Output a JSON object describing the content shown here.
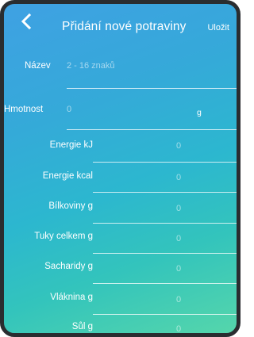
{
  "header": {
    "back_icon": "chevron-left-icon",
    "title": "Přidání nové potraviny",
    "save_label": "Uložit"
  },
  "form": {
    "name": {
      "label": "Název",
      "placeholder": "2 - 16 znaků"
    },
    "weight": {
      "label": "Hmotnost",
      "placeholder": "0",
      "unit": "g"
    },
    "nutrients": [
      {
        "label": "Energie kJ",
        "value": "0"
      },
      {
        "label": "Energie kcal",
        "value": "0"
      },
      {
        "label": "Bílkoviny g",
        "value": "0"
      },
      {
        "label": "Tuky celkem g",
        "value": "0"
      },
      {
        "label": "Sacharidy g",
        "value": "0"
      },
      {
        "label": "Vláknina g",
        "value": "0"
      },
      {
        "label": "Sůl g",
        "value": "0"
      }
    ]
  }
}
